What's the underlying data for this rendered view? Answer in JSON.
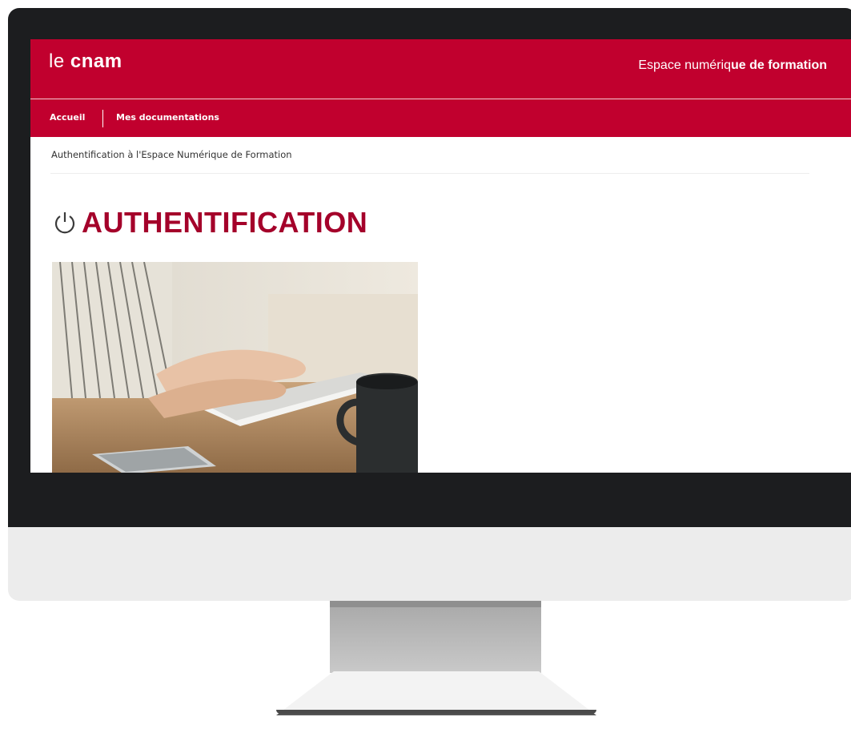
{
  "header": {
    "logo_prefix": "le ",
    "logo_brand": "cnam",
    "site_title_plain": "Espace numériq",
    "site_title_bold": "ue de formation"
  },
  "nav": {
    "items": [
      {
        "label": "Accueil"
      },
      {
        "label": "Mes documentations"
      }
    ]
  },
  "breadcrumb": "Authentification à l'Espace Numérique de Formation",
  "page": {
    "title": "AUTHENTIFICATION",
    "title_icon": "power-icon",
    "photo": "hands-typing-on-keyboard-image"
  },
  "colors": {
    "brand_red": "#c1002e",
    "title_red": "#a4002a"
  }
}
